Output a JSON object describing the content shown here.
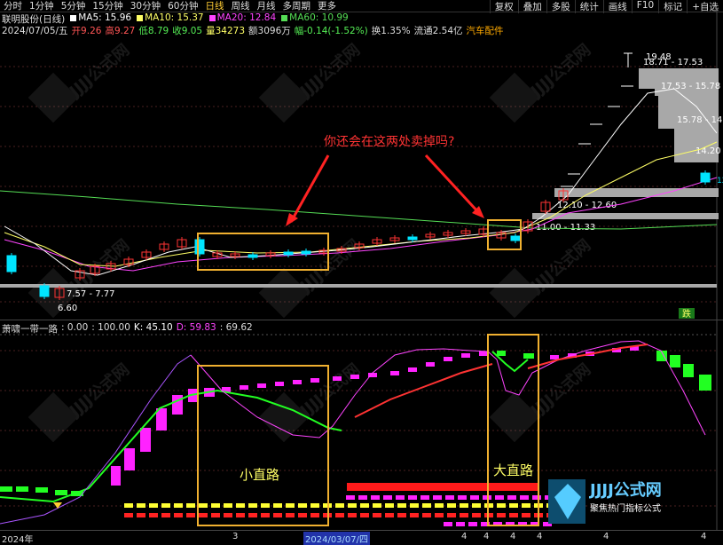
{
  "toolbar": {
    "periods": [
      "分时",
      "1分钟",
      "5分钟",
      "15分钟",
      "30分钟",
      "60分钟",
      "日线",
      "周线",
      "月线",
      "多周期",
      "更多"
    ],
    "active_period": "日线",
    "right_buttons": [
      "复权",
      "叠加",
      "多股",
      "统计",
      "画线",
      "F10",
      "标记",
      "+自选"
    ]
  },
  "stock": {
    "title": "联明股份(日线)",
    "ma_labels": [
      {
        "text": "MA5: 15.96",
        "color": "#ffffff"
      },
      {
        "text": "MA10: 15.37",
        "color": "#ffff66"
      },
      {
        "text": "MA20: 12.84",
        "color": "#ff44ff"
      },
      {
        "text": "MA60: 10.99",
        "color": "#55dd55"
      }
    ],
    "info": [
      {
        "text": "2024/07/05/五",
        "color": "#dddddd"
      },
      {
        "text": "开9.26",
        "color": "#ff5555"
      },
      {
        "text": "高9.27",
        "color": "#ff5555"
      },
      {
        "text": "低8.79",
        "color": "#55ee55"
      },
      {
        "text": "收9.05",
        "color": "#55ee55"
      },
      {
        "text": "量34273",
        "color": "#ffff66"
      },
      {
        "text": "额3096万",
        "color": "#dddddd"
      },
      {
        "text": "幅-0.14(-1.52%)",
        "color": "#55ee55"
      },
      {
        "text": "换1.35%",
        "color": "#dddddd"
      },
      {
        "text": "流通2.54亿",
        "color": "#dddddd"
      },
      {
        "text": "汽车配件",
        "color": "#ffaa00"
      }
    ]
  },
  "main_chart": {
    "annotation": "你还会在这两处卖掉吗?",
    "price_labels": {
      "high": "19.48",
      "low": "6.60",
      "zones": [
        "18.71 - 17.53",
        "17.53 - 15.78",
        "15.78 - 14",
        "14.20",
        "12.10 - 12.60",
        "11.00 - 11.33",
        "7.57 - 7.77"
      ],
      "edge_value": "12"
    },
    "fall_badge": "跌"
  },
  "indicator": {
    "name": "萧啸一带一路",
    "values": [
      {
        "text": ": 0.00",
        "color": "#dddddd"
      },
      {
        "text": ": 100.00",
        "color": "#dddddd"
      },
      {
        "text": "K: 45.10",
        "color": "#ffffff"
      },
      {
        "text": "D: 59.83",
        "color": "#ff44ff"
      },
      {
        "text": ": 69.62",
        "color": "#dddddd"
      }
    ],
    "box_labels": [
      "小直路",
      "大直路"
    ]
  },
  "date_axis": {
    "labels": [
      "2024年",
      "3",
      "2024/03/07/四",
      "4",
      "4",
      "4",
      "4",
      "4",
      "4"
    ]
  },
  "watermark": {
    "brand": "JJJJ公式网",
    "sub": "聚焦热门指标公式"
  },
  "colors": {
    "up": "#ff3333",
    "down": "#00e5ff",
    "ma5": "#ffffff",
    "ma10": "#ffff66",
    "ma20": "#ff44ff",
    "ma60": "#55dd55",
    "box": "#f0b030",
    "magenta": "#ff22ff",
    "green": "#22ff22"
  }
}
